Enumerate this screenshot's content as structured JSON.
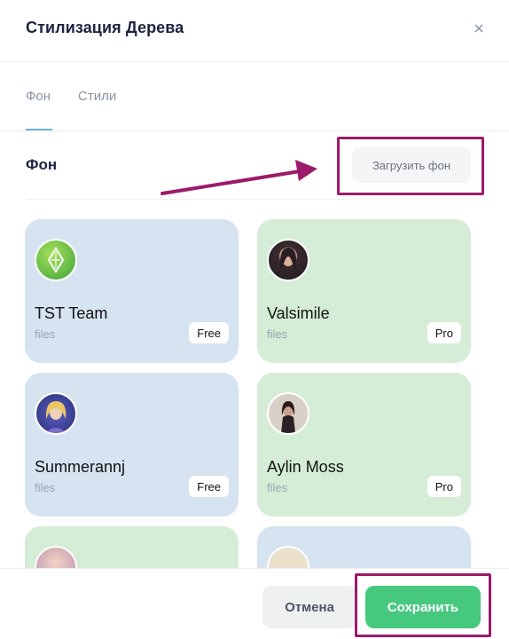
{
  "dialog": {
    "title": "Стилизация Дерева"
  },
  "tabs": [
    {
      "label": "Фон",
      "active": true
    },
    {
      "label": "Стили",
      "active": false
    }
  ],
  "section": {
    "title": "Фон",
    "upload_label": "Загрузить фон"
  },
  "cards": [
    {
      "name": "TST Team",
      "sub": "files",
      "badge": "Free",
      "color": "blue",
      "icon": "tst-logo-icon"
    },
    {
      "name": "Valsimile",
      "sub": "files",
      "badge": "Pro",
      "color": "green",
      "icon": "avatar-photo"
    },
    {
      "name": "Summerannj",
      "sub": "files",
      "badge": "Free",
      "color": "blue",
      "icon": "avatar-photo"
    },
    {
      "name": "Aylin Moss",
      "sub": "files",
      "badge": "Pro",
      "color": "green",
      "icon": "avatar-photo"
    }
  ],
  "footer": {
    "cancel_label": "Отмена",
    "save_label": "Сохранить"
  },
  "colors": {
    "accent_green": "#46c97e",
    "annotation": "#9c1a6b",
    "card_blue": "#d6e3f1",
    "card_green": "#d5edd6"
  }
}
